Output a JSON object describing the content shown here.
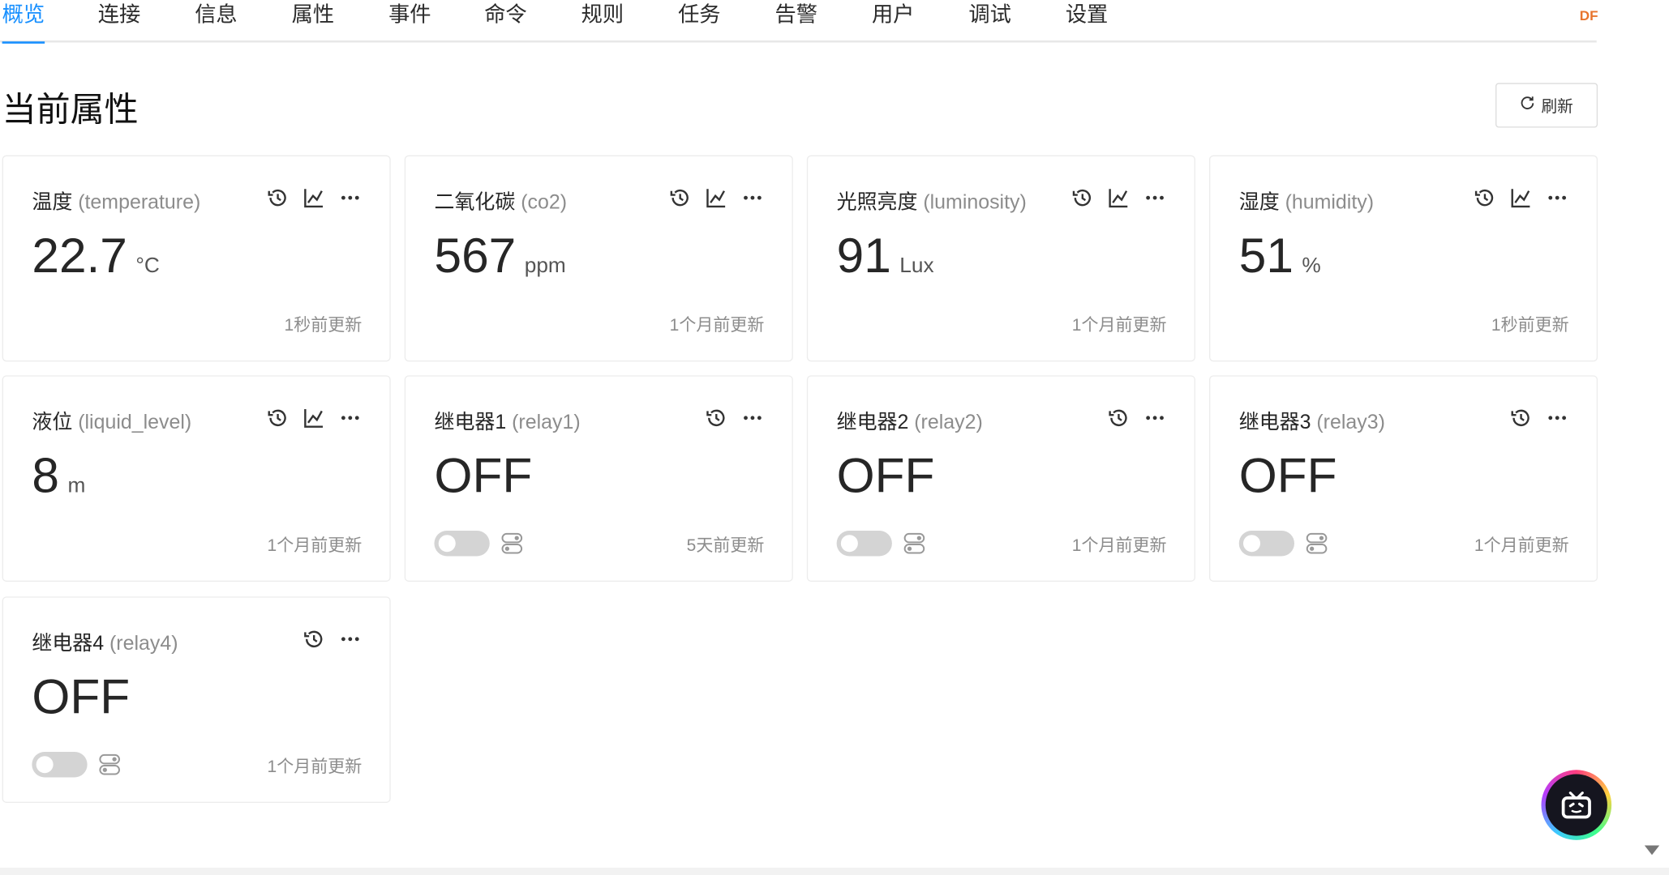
{
  "tabs": [
    {
      "label": "概览",
      "active": true
    },
    {
      "label": "连接"
    },
    {
      "label": "信息"
    },
    {
      "label": "属性"
    },
    {
      "label": "事件"
    },
    {
      "label": "命令"
    },
    {
      "label": "规则"
    },
    {
      "label": "任务"
    },
    {
      "label": "告警"
    },
    {
      "label": "用户"
    },
    {
      "label": "调试"
    },
    {
      "label": "设置"
    }
  ],
  "brand": "DF",
  "page_title": "当前属性",
  "refresh_label": "刷新",
  "cards": [
    {
      "name": "温度",
      "ident": "(temperature)",
      "value": "22.7",
      "unit": "°C",
      "updated": "1秒前更新"
    },
    {
      "name": "二氧化碳",
      "ident": "(co2)",
      "value": "567",
      "unit": "ppm",
      "updated": "1个月前更新"
    },
    {
      "name": "光照亮度",
      "ident": "(luminosity)",
      "value": "91",
      "unit": "Lux",
      "updated": "1个月前更新"
    },
    {
      "name": "湿度",
      "ident": "(humidity)",
      "value": "51",
      "unit": "%",
      "updated": "1秒前更新"
    },
    {
      "name": "液位",
      "ident": "(liquid_level)",
      "value": "8",
      "unit": "m",
      "updated": "1个月前更新"
    },
    {
      "name": "继电器1",
      "ident": "(relay1)",
      "value": "OFF",
      "unit": "",
      "updated": "5天前更新"
    },
    {
      "name": "继电器2",
      "ident": "(relay2)",
      "value": "OFF",
      "unit": "",
      "updated": "1个月前更新"
    },
    {
      "name": "继电器3",
      "ident": "(relay3)",
      "value": "OFF",
      "unit": "",
      "updated": "1个月前更新"
    },
    {
      "name": "继电器4",
      "ident": "(relay4)",
      "value": "OFF",
      "unit": "",
      "updated": "1个月前更新"
    }
  ],
  "icons": {
    "history": "history-icon",
    "chart": "line-chart-icon",
    "more": "more-icon",
    "refresh": "refresh-icon",
    "toggle": "toggle-icon",
    "assistant": "tv-icon"
  },
  "colors": {
    "accent": "#1890ff",
    "brand": "#e8742d"
  }
}
